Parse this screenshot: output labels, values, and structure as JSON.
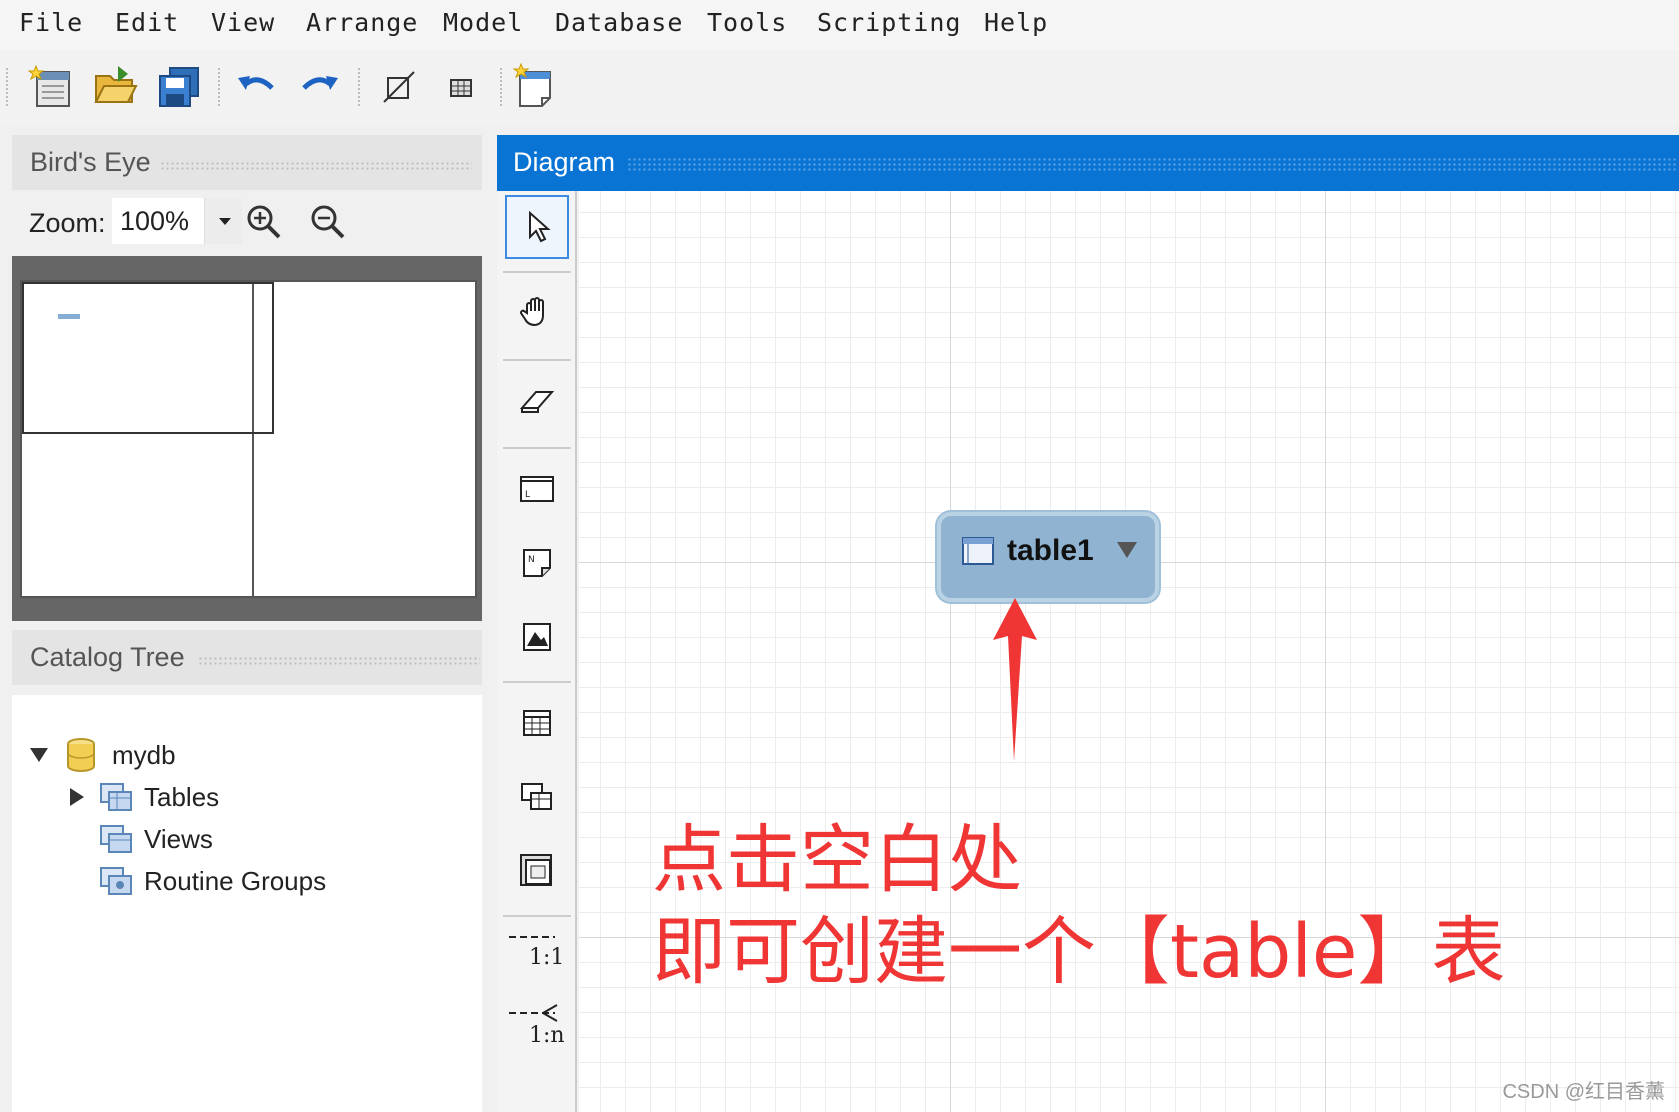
{
  "menu": {
    "items": [
      "File",
      "Edit",
      "View",
      "Arrange",
      "Model",
      "Database",
      "Tools",
      "Scripting",
      "Help"
    ]
  },
  "toolbar": {
    "buttons": [
      "new-document-icon",
      "open-folder-icon",
      "save-icon",
      "undo-icon",
      "redo-icon",
      "toggle-grid-icon",
      "align-icon",
      "new-diagram-icon"
    ]
  },
  "birds_eye": {
    "title": "Bird's Eye",
    "zoom_label": "Zoom:",
    "zoom_value": "100%"
  },
  "catalog_tree": {
    "title": "Catalog Tree",
    "schema": "mydb",
    "children": [
      "Tables",
      "Views",
      "Routine Groups"
    ]
  },
  "diagram": {
    "title": "Diagram",
    "palette": [
      "select-pointer-icon",
      "hand-icon",
      "eraser-icon",
      "layer-icon",
      "note-icon",
      "image-icon",
      "table-icon",
      "view-icon",
      "routine-group-icon"
    ],
    "relationship_1_1": "1:1",
    "relationship_1_n": "1:n",
    "table_name": "table1"
  },
  "annotation": {
    "line1": "点击空白处",
    "line2": "即可创建一个【table】表"
  },
  "watermark": "CSDN @红目香薰",
  "colors": {
    "diagram_header": "#0a74d4",
    "table_fill": "#8fb3d0",
    "annotation_red": "#f03535"
  }
}
